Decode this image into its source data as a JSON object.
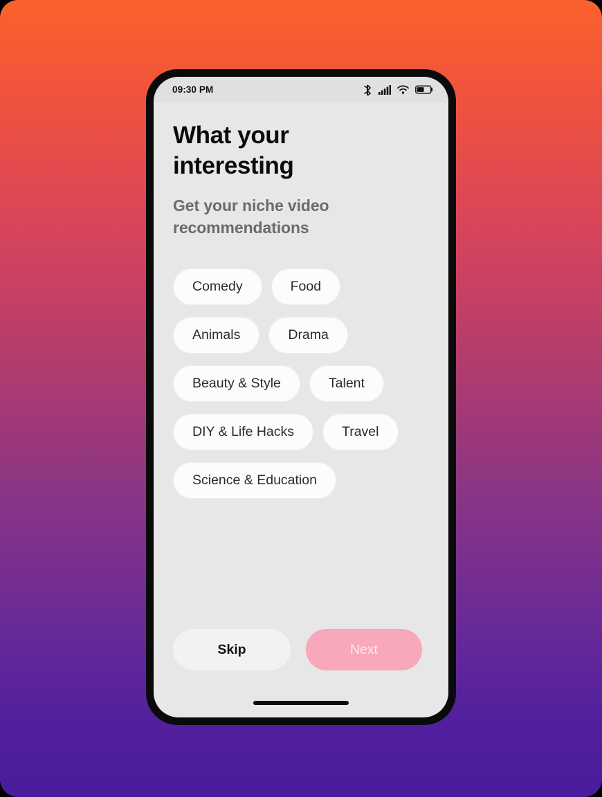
{
  "status_bar": {
    "time": "09:30 PM",
    "icons": [
      "bluetooth-icon",
      "cellular-signal-icon",
      "wifi-icon",
      "battery-icon"
    ]
  },
  "screen": {
    "title": "What your interesting",
    "subtitle": "Get your niche video recommendations"
  },
  "chips": [
    {
      "label": "Comedy"
    },
    {
      "label": "Food"
    },
    {
      "label": "Animals"
    },
    {
      "label": "Drama"
    },
    {
      "label": "Beauty & Style"
    },
    {
      "label": "Talent"
    },
    {
      "label": "DIY & Life Hacks"
    },
    {
      "label": "Travel"
    },
    {
      "label": "Science & Education"
    }
  ],
  "actions": {
    "skip_label": "Skip",
    "next_label": "Next"
  },
  "colors": {
    "gradient_top": "#F9622C",
    "gradient_mid": "#B03C6E",
    "gradient_bottom": "#481C9B",
    "screen_background": "#E7E7E7",
    "status_bar_background": "#E0E0E0",
    "chip_background": "#FCFCFC",
    "next_button": "#F9A7BA",
    "next_button_text": "#FDEBF0",
    "skip_button": "#F2F2F2",
    "title_text": "#0b0b0b",
    "subtitle_text": "#6b6b6b"
  }
}
